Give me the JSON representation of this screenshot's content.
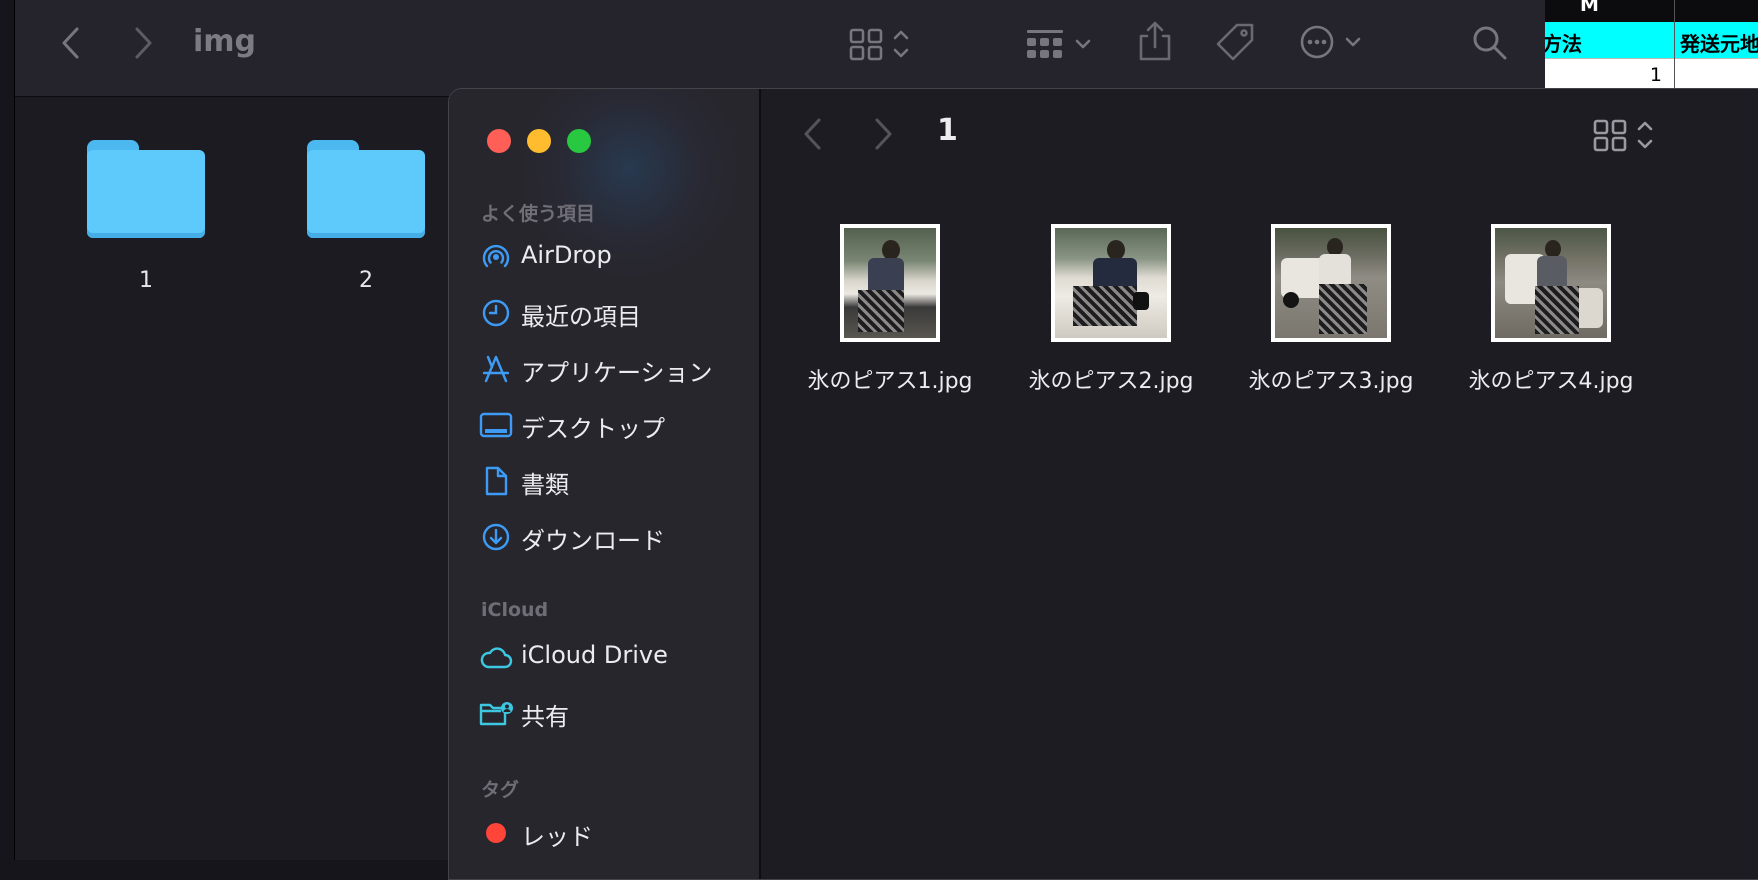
{
  "spreadsheet": {
    "column_letter": "M",
    "header_cell_a": "方法",
    "header_cell_b": "発送元地",
    "value_cell": "1",
    "header_color": "#00ffff"
  },
  "back_window": {
    "title": "img",
    "folders": [
      {
        "label": "1"
      },
      {
        "label": "2"
      }
    ]
  },
  "front_window": {
    "title": "1",
    "traffic_lights": {
      "close": "#ff5f57",
      "minimize": "#febc2e",
      "zoom": "#28c840"
    },
    "sidebar": {
      "favorites_heading": "よく使う項目",
      "favorites": [
        {
          "label": "AirDrop",
          "icon": "airdrop-icon"
        },
        {
          "label": "最近の項目",
          "icon": "clock-icon"
        },
        {
          "label": "アプリケーション",
          "icon": "applications-icon"
        },
        {
          "label": "デスクトップ",
          "icon": "desktop-icon"
        },
        {
          "label": "書類",
          "icon": "document-icon"
        },
        {
          "label": "ダウンロード",
          "icon": "download-icon"
        }
      ],
      "icloud_heading": "iCloud",
      "icloud": [
        {
          "label": "iCloud Drive",
          "icon": "cloud-icon"
        },
        {
          "label": "共有",
          "icon": "shared-folder-icon"
        }
      ],
      "tags_heading": "タグ",
      "tags": [
        {
          "label": "レッド",
          "color": "#ff453a"
        }
      ]
    },
    "files": [
      {
        "name": "氷のピアス1.jpg"
      },
      {
        "name": "氷のピアス2.jpg"
      },
      {
        "name": "氷のピアス3.jpg"
      },
      {
        "name": "氷のピアス4.jpg"
      }
    ]
  }
}
